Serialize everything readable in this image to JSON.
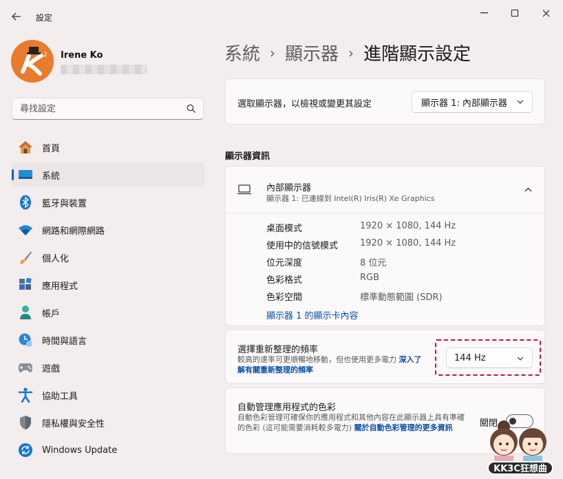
{
  "window": {
    "title": "設定",
    "back_icon": "back-arrow-icon"
  },
  "user": {
    "name": "Irene Ko"
  },
  "search": {
    "placeholder": "尋找設定"
  },
  "nav": {
    "items": [
      {
        "label": "首頁",
        "icon": "home-icon"
      },
      {
        "label": "系統",
        "icon": "system-icon",
        "active": true
      },
      {
        "label": "藍牙與裝置",
        "icon": "bluetooth-icon"
      },
      {
        "label": "網路和網際網路",
        "icon": "wifi-icon"
      },
      {
        "label": "個人化",
        "icon": "brush-icon"
      },
      {
        "label": "應用程式",
        "icon": "apps-icon"
      },
      {
        "label": "帳戶",
        "icon": "account-icon"
      },
      {
        "label": "時間與語言",
        "icon": "time-language-icon"
      },
      {
        "label": "遊戲",
        "icon": "gaming-icon"
      },
      {
        "label": "協助工具",
        "icon": "accessibility-icon"
      },
      {
        "label": "隱私權與安全性",
        "icon": "shield-icon"
      },
      {
        "label": "Windows Update",
        "icon": "update-icon"
      }
    ]
  },
  "breadcrumb": {
    "level1": "系統",
    "level2": "顯示器",
    "current": "進階顯示設定",
    "separator": "›"
  },
  "select_display": {
    "label": "選取顯示器，以檢視或變更其設定",
    "value": "顯示器 1: 內部顯示器"
  },
  "display_info": {
    "section_title": "顯示器資訊",
    "title": "內部顯示器",
    "subtitle": "顯示器 1: 已連線到 Intel(R) Iris(R) Xe Graphics",
    "rows": [
      {
        "label": "桌面模式",
        "value": "1920 × 1080, 144 Hz"
      },
      {
        "label": "使用中的信號模式",
        "value": "1920 × 1080, 144 Hz"
      },
      {
        "label": "位元深度",
        "value": "8 位元"
      },
      {
        "label": "色彩格式",
        "value": "RGB"
      },
      {
        "label": "色彩空間",
        "value": "標準動態範圍 (SDR)"
      }
    ],
    "link": "顯示器 1 的顯示卡內容"
  },
  "refresh_rate": {
    "title": "選擇重新整理的頻率",
    "desc": "較高的速率可更順暢地移動，但也使用更多電力",
    "link": "深入了解有關重新整理的頻率",
    "value": "144 Hz"
  },
  "color_management": {
    "title": "自動管理應用程式的色彩",
    "desc": "自動色彩管理可確保你的應用程式和其他內容在此顯示器上具有準確的色彩 (這可能需要消耗較多電力)",
    "link": "關於自動色彩管理的更多資訊",
    "toggle_label": "關閉",
    "toggle_on": false
  },
  "watermark": {
    "text": "KK3C狂想曲"
  },
  "colors": {
    "accent": "#0a62c2",
    "link": "#0a4fa6",
    "highlight": "#c8102e"
  }
}
